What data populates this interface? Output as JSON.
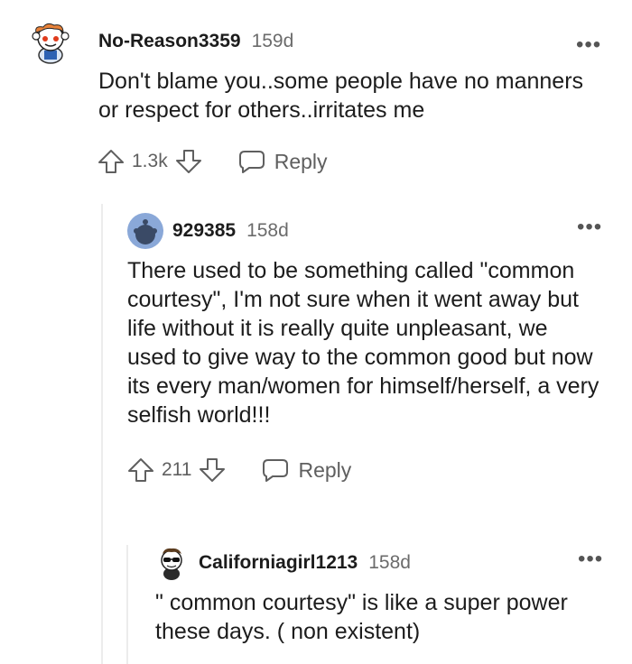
{
  "comments": [
    {
      "username": "No-Reason3359",
      "age": "159d",
      "text": "Don't blame you..some people have no manners or respect for others..irritates me",
      "score": "1.3k",
      "reply_label": "Reply"
    },
    {
      "username": "929385",
      "age": "158d",
      "text": "There used to be something called \"common courtesy\", I'm not sure when it went away but life without it is really quite unpleasant, we used to give way to the common good but now its every man/women for himself/herself, a very selfish world!!!",
      "score": "211",
      "reply_label": "Reply"
    },
    {
      "username": "Californiagirl1213",
      "age": "158d",
      "text": "\" common courtesy\" is like a super power these days. ( non existent)"
    }
  ],
  "icons": {
    "more": "more-options-icon",
    "upvote": "upvote-arrow-icon",
    "downvote": "downvote-arrow-icon",
    "reply": "speech-bubble-icon"
  },
  "colors": {
    "meta_gray": "#6b6b6b",
    "avatar_blue": "#8aa8d8"
  }
}
